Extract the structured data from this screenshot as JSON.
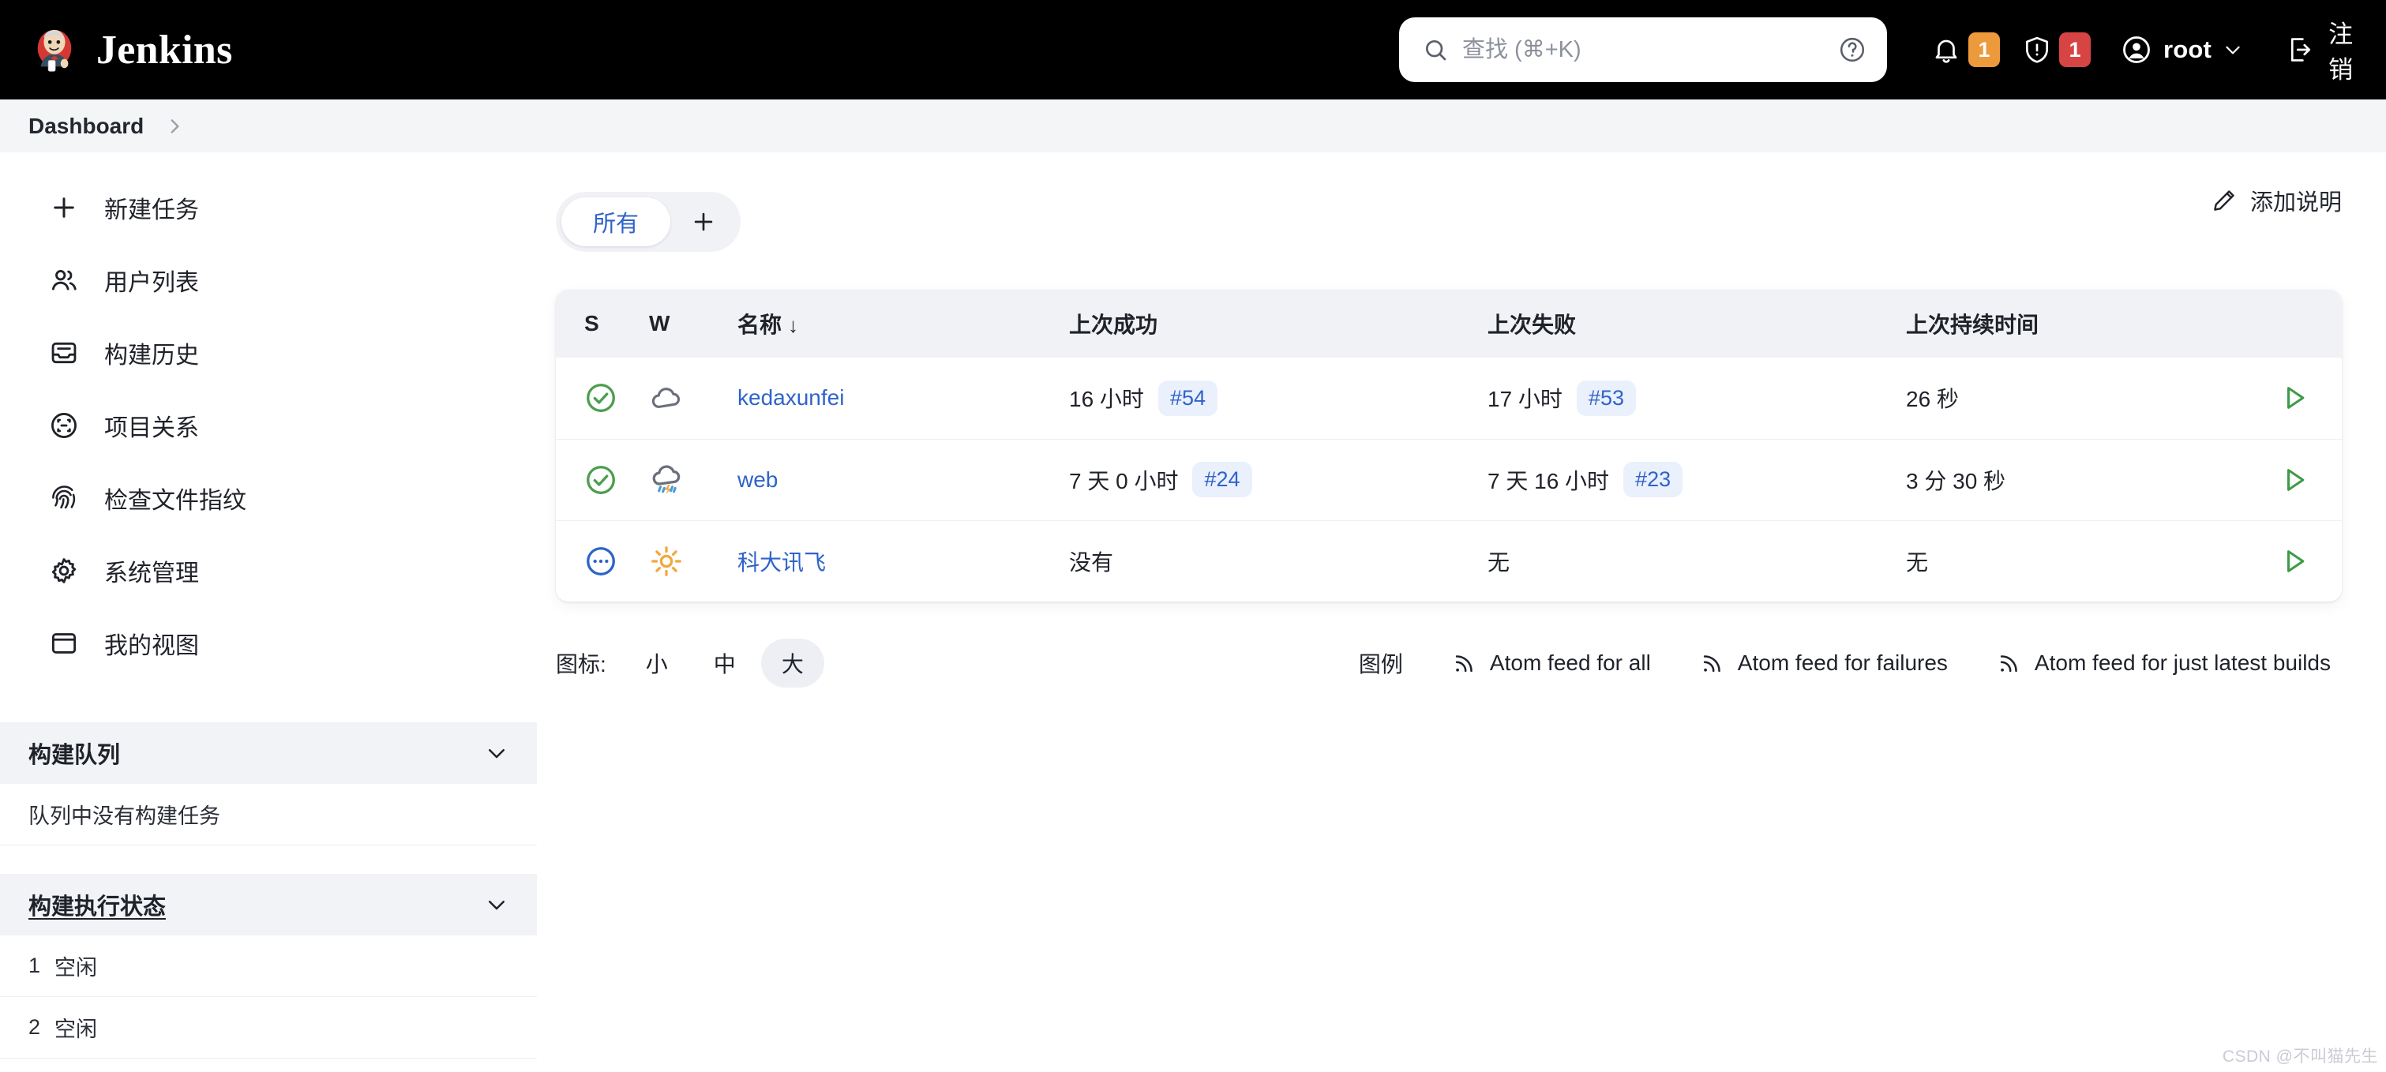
{
  "header": {
    "brand": "Jenkins",
    "brand_logo_icon": "jenkins-butler-logo",
    "search": {
      "placeholder": "查找 (⌘+K)",
      "value": "",
      "search_icon": "search-icon",
      "help_icon": "help-circle-icon"
    },
    "notifications": {
      "icon": "bell-icon",
      "count": "1",
      "color": "#ec9a3c"
    },
    "security": {
      "icon": "shield-warning-icon",
      "count": "1",
      "color": "#d64444"
    },
    "user": {
      "icon": "user-circle-icon",
      "name": "root",
      "chevron_icon": "chevron-down-icon"
    },
    "logout": {
      "icon": "logout-icon",
      "label": "注销"
    }
  },
  "breadcrumb": {
    "items": [
      "Dashboard"
    ],
    "separator_icon": "chevron-right-icon"
  },
  "sidebar": {
    "nav": [
      {
        "label": "新建任务",
        "icon": "plus-icon"
      },
      {
        "label": "用户列表",
        "icon": "users-icon"
      },
      {
        "label": "构建历史",
        "icon": "inbox-icon"
      },
      {
        "label": "项目关系",
        "icon": "project-relationship-icon"
      },
      {
        "label": "检查文件指纹",
        "icon": "fingerprint-icon"
      },
      {
        "label": "系统管理",
        "icon": "gear-icon"
      },
      {
        "label": "我的视图",
        "icon": "window-icon"
      }
    ],
    "build_queue": {
      "title": "构建队列",
      "chevron_icon": "chevron-down-icon",
      "empty_text": "队列中没有构建任务"
    },
    "build_executor": {
      "title": "构建执行状态",
      "chevron_icon": "chevron-down-icon",
      "executors": [
        {
          "num": "1",
          "status": "空闲"
        },
        {
          "num": "2",
          "status": "空闲"
        }
      ]
    }
  },
  "main": {
    "describe_button": {
      "label": "添加说明",
      "icon": "pencil-icon"
    },
    "tabs": [
      {
        "label": "所有",
        "active": true
      }
    ],
    "add_tab": {
      "icon": "plus-icon"
    },
    "table": {
      "columns": [
        "S",
        "W",
        "名称",
        "上次成功",
        "上次失败",
        "上次持续时间",
        ""
      ],
      "sort_column": "名称",
      "sort_arrow": "↓",
      "rows": [
        {
          "status_icon": "success-check-circle-icon",
          "weather_icon": "cloudy-icon",
          "name": "kedaxunfei",
          "last_success": "16 小时",
          "last_success_build": "#54",
          "last_failure": "17 小时",
          "last_failure_build": "#53",
          "last_duration": "26 秒",
          "action_icon": "build-now-play-icon"
        },
        {
          "status_icon": "success-check-circle-icon",
          "weather_icon": "storm-rain-icon",
          "name": "web",
          "last_success": "7 天 0 小时",
          "last_success_build": "#24",
          "last_failure": "7 天 16 小时",
          "last_failure_build": "#23",
          "last_duration": "3 分 30 秒",
          "action_icon": "build-now-play-icon"
        },
        {
          "status_icon": "pending-dots-circle-icon",
          "weather_icon": "sunny-icon",
          "name": "科大讯飞",
          "last_success": "没有",
          "last_success_build": "",
          "last_failure": "无",
          "last_failure_build": "",
          "last_duration": "无",
          "action_icon": "build-now-play-icon"
        }
      ]
    },
    "footer": {
      "icon_size_label": "图标:",
      "icon_sizes": [
        {
          "label": "小",
          "active": false
        },
        {
          "label": "中",
          "active": false
        },
        {
          "label": "大",
          "active": true
        }
      ],
      "legend_label": "图例",
      "feeds": [
        {
          "label": "Atom feed for all",
          "icon": "rss-icon"
        },
        {
          "label": "Atom feed for failures",
          "icon": "rss-icon"
        },
        {
          "label": "Atom feed for just latest builds",
          "icon": "rss-icon"
        }
      ]
    }
  },
  "watermark": "CSDN @不叫猫先生",
  "colors": {
    "link": "#2f63c9",
    "success": "#4a9e4e",
    "pending": "#2f63c9",
    "badge_orange": "#ec9a3c",
    "badge_red": "#d64444",
    "header_bg": "#000000",
    "panel_bg": "#f1f2f6"
  }
}
